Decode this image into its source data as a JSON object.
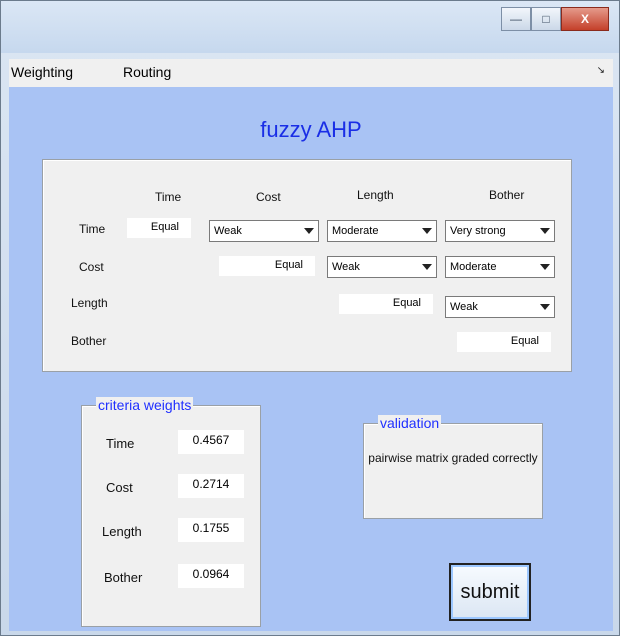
{
  "menubar": {
    "items": [
      "Weighting",
      "Routing"
    ]
  },
  "window_controls": {
    "minimize": "—",
    "maximize": "□",
    "close": "X"
  },
  "title": "fuzzy AHP",
  "matrix": {
    "col_headers": [
      "Time",
      "Cost",
      "Length",
      "Bother"
    ],
    "row_labels": [
      "Time",
      "Cost",
      "Length",
      "Bother"
    ],
    "diag": [
      "Equal",
      "Equal",
      "Equal",
      "Equal"
    ],
    "selects": {
      "time_cost": "Weak",
      "time_length": "Moderate",
      "time_bother": "Very strong",
      "cost_length": "Weak",
      "cost_bother": "Moderate",
      "length_bother": "Weak"
    }
  },
  "weights": {
    "legend": "criteria weights",
    "items": [
      {
        "label": "Time",
        "value": "0.4567"
      },
      {
        "label": "Cost",
        "value": "0.2714"
      },
      {
        "label": "Length",
        "value": "0.1755"
      },
      {
        "label": "Bother",
        "value": "0.0964"
      }
    ]
  },
  "validation": {
    "legend": "validation",
    "message": "pairwise matrix graded correctly"
  },
  "submit_label": "submit"
}
